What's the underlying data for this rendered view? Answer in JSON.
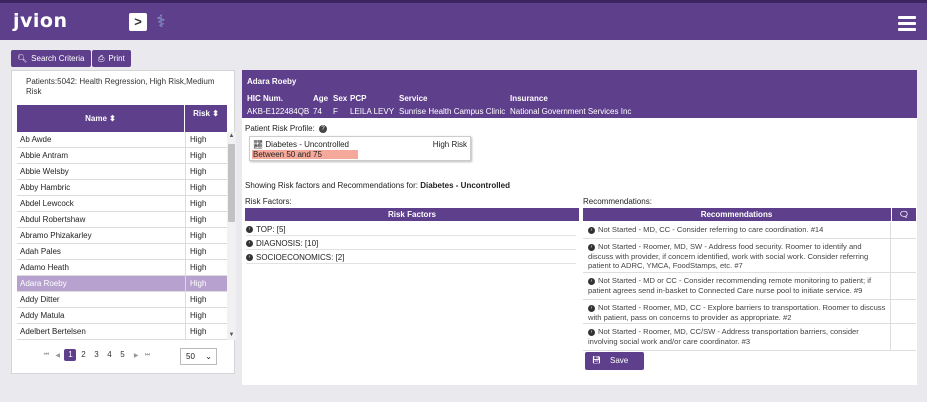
{
  "app": {
    "logo": "jvion",
    "nav_toggle_glyph": ">",
    "brand_icon": "caduceus-icon"
  },
  "toolbar": {
    "search_criteria_label": "Search Criteria",
    "print_label": "Print"
  },
  "patient_list": {
    "summary": "Patients:5042: Health Regression, High Risk,Medium Risk",
    "columns": {
      "name": "Name ⬍",
      "risk": "Risk ⬍"
    },
    "rows": [
      {
        "name": "Ab Awde",
        "risk": "High"
      },
      {
        "name": "Abbie Antram",
        "risk": "High"
      },
      {
        "name": "Abbie Welsby",
        "risk": "High"
      },
      {
        "name": "Abby Hambric",
        "risk": "High"
      },
      {
        "name": "Abdel Lewcock",
        "risk": "High"
      },
      {
        "name": "Abdul Robertshaw",
        "risk": "High"
      },
      {
        "name": "Abramo Phizakarley",
        "risk": "High"
      },
      {
        "name": "Adah Pales",
        "risk": "High"
      },
      {
        "name": "Adamo Heath",
        "risk": "High"
      },
      {
        "name": "Adara Roeby",
        "risk": "High"
      },
      {
        "name": "Addy Ditter",
        "risk": "High"
      },
      {
        "name": "Addy Matula",
        "risk": "High"
      },
      {
        "name": "Adelbert Bertelsen",
        "risk": "High"
      }
    ],
    "selected_index": 9,
    "pager": {
      "pages": [
        "1",
        "2",
        "3",
        "4",
        "5"
      ],
      "current_page": "1",
      "page_size": "50"
    }
  },
  "patient": {
    "name": "Adara Roeby",
    "labels": {
      "hic": "HIC Num.",
      "age": "Age",
      "sex": "Sex",
      "pcp": "PCP",
      "service": "Service",
      "insurance": "Insurance"
    },
    "values": {
      "hic": "AKB-E122484QB",
      "age": "74",
      "sex": "F",
      "pcp": "LEILA LEVY",
      "service": "Sunrise Health Campus Clinic",
      "insurance": "National Government Services Inc"
    }
  },
  "risk_profile": {
    "title": "Patient Risk Profile:",
    "condition": "Diabetes - Uncontrolled",
    "level": "High Risk",
    "band": "Between 50 and 75"
  },
  "showing": {
    "prefix": "Showing Risk factors and Recommendations for:",
    "condition": "Diabetes - Uncontrolled"
  },
  "risk_factors": {
    "section_label": "Risk Factors:",
    "header": "Risk Factors",
    "items": [
      "TOP: [5]",
      "DIAGNOSIS: [10]",
      "SOCIOECONOMICS: [2]"
    ]
  },
  "recommendations": {
    "section_label": "Recommendations:",
    "header": "Recommendations",
    "items": [
      "Not Started - MD, CC - Consider referring to care coordination. #14",
      "Not Started - Roomer, MD, SW - Address food security. Roomer to identify and discuss with provider, if concern identified, work with social work. Consider referring patient to ADRC, YMCA, FoodStamps, etc. #7",
      "Not Started - MD or CC - Consider recommending remote monitoring to patient; if patient agrees send in-basket to Connected Care nurse pool to initiate service. #9",
      "Not Started - Roomer, MD, CC - Explore barriers to transportation. Roomer to discuss with patient, pass on concerns to provider as appropriate. #2",
      "Not Started - Roomer, MD, CC/SW - Address transportation barriers, consider involving social work and/or care coordinator. #3"
    ],
    "save_label": "Save"
  }
}
